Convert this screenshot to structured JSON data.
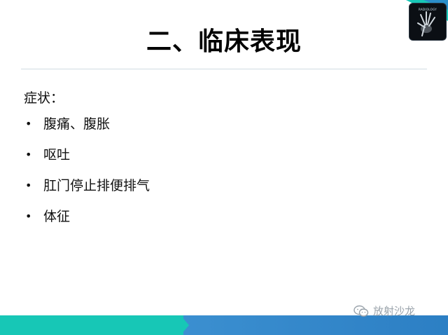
{
  "slide": {
    "title": "二、临床表现",
    "subheading": "症状：",
    "bullet_char": "•",
    "bullets": [
      "腹痛、腹胀",
      "呕吐",
      "肛门停止排便排气",
      "体征"
    ]
  },
  "logo": {
    "text": "RADIOLOGY",
    "icon": "hand-xray-icon"
  },
  "watermark": {
    "icon": "wechat-icon",
    "text": "放射沙龙"
  },
  "colors": {
    "teal": "#17c7b6",
    "blue": "#2c7fc4",
    "rule": "#cfdbe2",
    "watermark": "#9aa3ab"
  }
}
